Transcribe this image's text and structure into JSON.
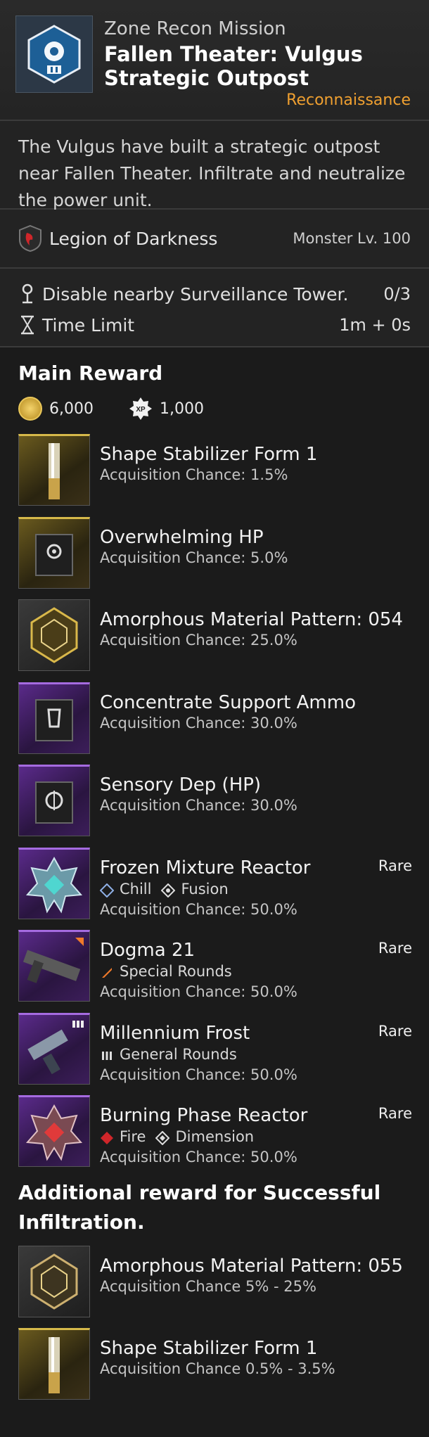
{
  "header": {
    "subtitle": "Zone Recon Mission",
    "title": "Fallen Theater: Vulgus Strategic Outpost",
    "type": "Reconnaissance",
    "icon": "mission-target-icon"
  },
  "description": "The Vulgus have built a strategic outpost near Fallen Theater. Infiltrate and neutralize the power unit.",
  "faction": {
    "name": "Legion of Darkness",
    "level": "Monster Lv. 100",
    "icon": "legion-emblem-icon"
  },
  "objectives": [
    {
      "icon": "location-pin-icon",
      "text": "Disable nearby Surveillance Tower.",
      "value": "0/3"
    },
    {
      "icon": "hourglass-icon",
      "text": "Time Limit",
      "value": "1m + 0s"
    }
  ],
  "main_reward": {
    "title": "Main Reward",
    "gold": "6,000",
    "xp": "1,000",
    "xp_badge": "XP"
  },
  "rewards": [
    {
      "name": "Shape Stabilizer Form 1",
      "chance": "Acquisition Chance: 1.5%",
      "tier": "gold"
    },
    {
      "name": "Overwhelming HP",
      "chance": "Acquisition Chance: 5.0%",
      "tier": "gold"
    },
    {
      "name": "Amorphous Material Pattern: 054",
      "chance": "Acquisition Chance: 25.0%",
      "tier": "dark"
    },
    {
      "name": "Concentrate Support Ammo",
      "chance": "Acquisition Chance: 30.0%",
      "tier": "purple"
    },
    {
      "name": "Sensory Dep (HP)",
      "chance": "Acquisition Chance: 30.0%",
      "tier": "purple"
    },
    {
      "name": "Frozen Mixture Reactor",
      "rarity": "Rare",
      "tag1": "Chill",
      "tag2": "Fusion",
      "chance": "Acquisition Chance: 50.0%",
      "tier": "purple"
    },
    {
      "name": "Dogma 21",
      "rarity": "Rare",
      "tag1": "Special Rounds",
      "chance": "Acquisition Chance: 50.0%",
      "tier": "purple"
    },
    {
      "name": "Millennium Frost",
      "rarity": "Rare",
      "tag1": "General Rounds",
      "chance": "Acquisition Chance: 50.0%",
      "tier": "purple"
    },
    {
      "name": "Burning Phase Reactor",
      "rarity": "Rare",
      "tag1": "Fire",
      "tag2": "Dimension",
      "chance": "Acquisition Chance: 50.0%",
      "tier": "purple"
    }
  ],
  "additional": {
    "title": "Additional reward for Successful Infiltration.",
    "items": [
      {
        "name": "Amorphous Material Pattern: 055",
        "chance": "Acquisition Chance 5% - 25%",
        "tier": "dark"
      },
      {
        "name": "Shape Stabilizer Form 1",
        "chance": "Acquisition Chance 0.5% - 3.5%",
        "tier": "gold"
      }
    ]
  },
  "colors": {
    "accent_orange": "#f0a030",
    "rare_purple": "#a56be0",
    "gold_tier": "#d6b94a"
  }
}
